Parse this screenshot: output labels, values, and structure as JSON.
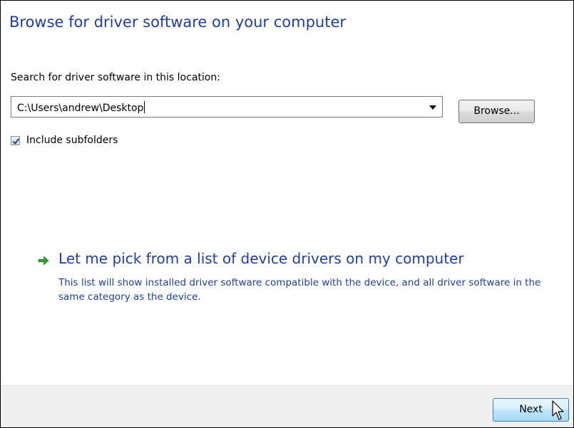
{
  "dialog": {
    "title": "Browse for driver software on your computer",
    "search_label": "Search for driver software in this location:",
    "location_value": "C:\\Users\\andrew\\Desktop",
    "browse_label": "Browse...",
    "include_subfolders": {
      "label": "Include subfolders",
      "checked": true
    },
    "pick_option": {
      "title": "Let me pick from a list of device drivers on my computer",
      "description": "This list will show installed driver software compatible with the device, and all driver software in the same category as the device."
    },
    "next_label": "Next"
  },
  "icons": {
    "dropdown": "chevron-down-icon",
    "checkmark": "checkmark-icon",
    "arrow": "green-arrow-icon",
    "cursor": "mouse-pointer-icon"
  },
  "colors": {
    "heading_blue": "#1e3f9b",
    "arrow_green": "#2ea12e",
    "footer_bg": "#f0f0f0"
  }
}
